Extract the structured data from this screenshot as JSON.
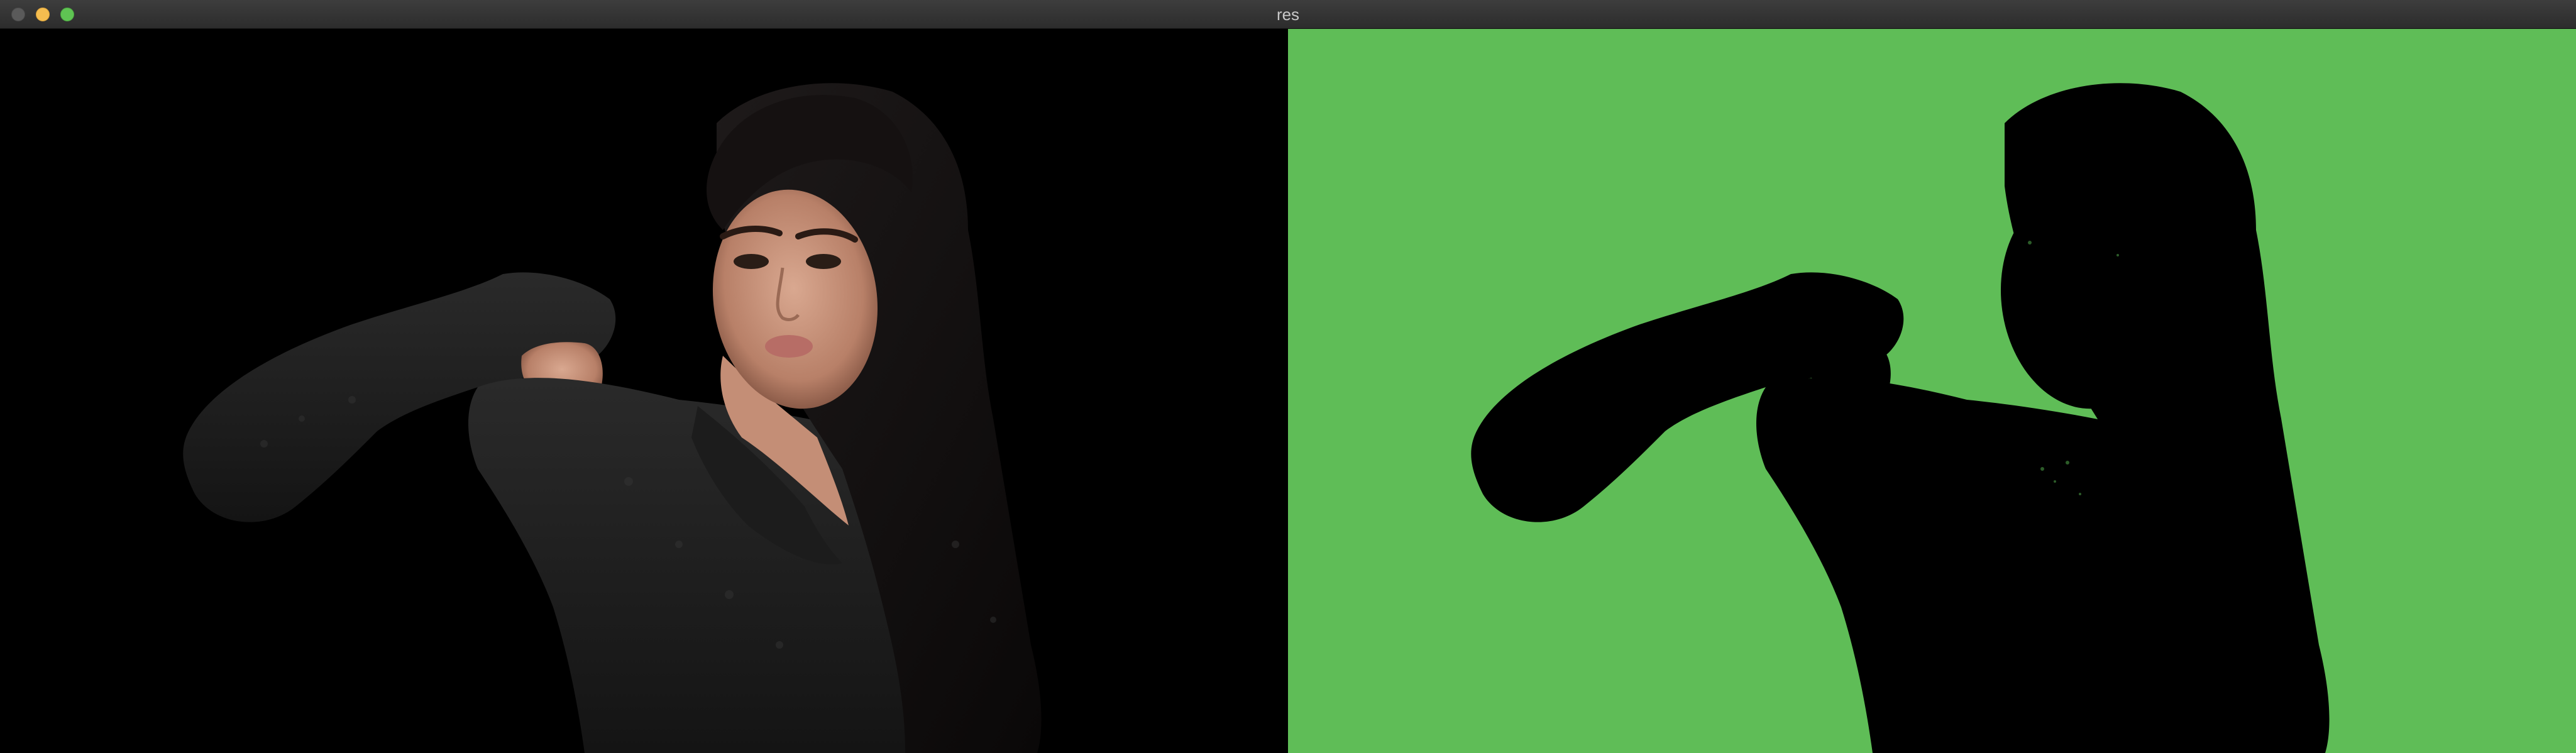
{
  "window": {
    "title": "res",
    "controls": [
      "close",
      "minimize",
      "zoom"
    ]
  },
  "panels": [
    {
      "name": "foreground-extracted",
      "background_color": "#000000"
    },
    {
      "name": "background-mask",
      "background_color": "#5ab853"
    }
  ],
  "colors": {
    "titlebar": "#353535",
    "close": "#5a5a5a",
    "minimize": "#f5bd4f",
    "zoom": "#5fc453",
    "green_screen": "#5ab853",
    "silhouette": "#000000"
  }
}
